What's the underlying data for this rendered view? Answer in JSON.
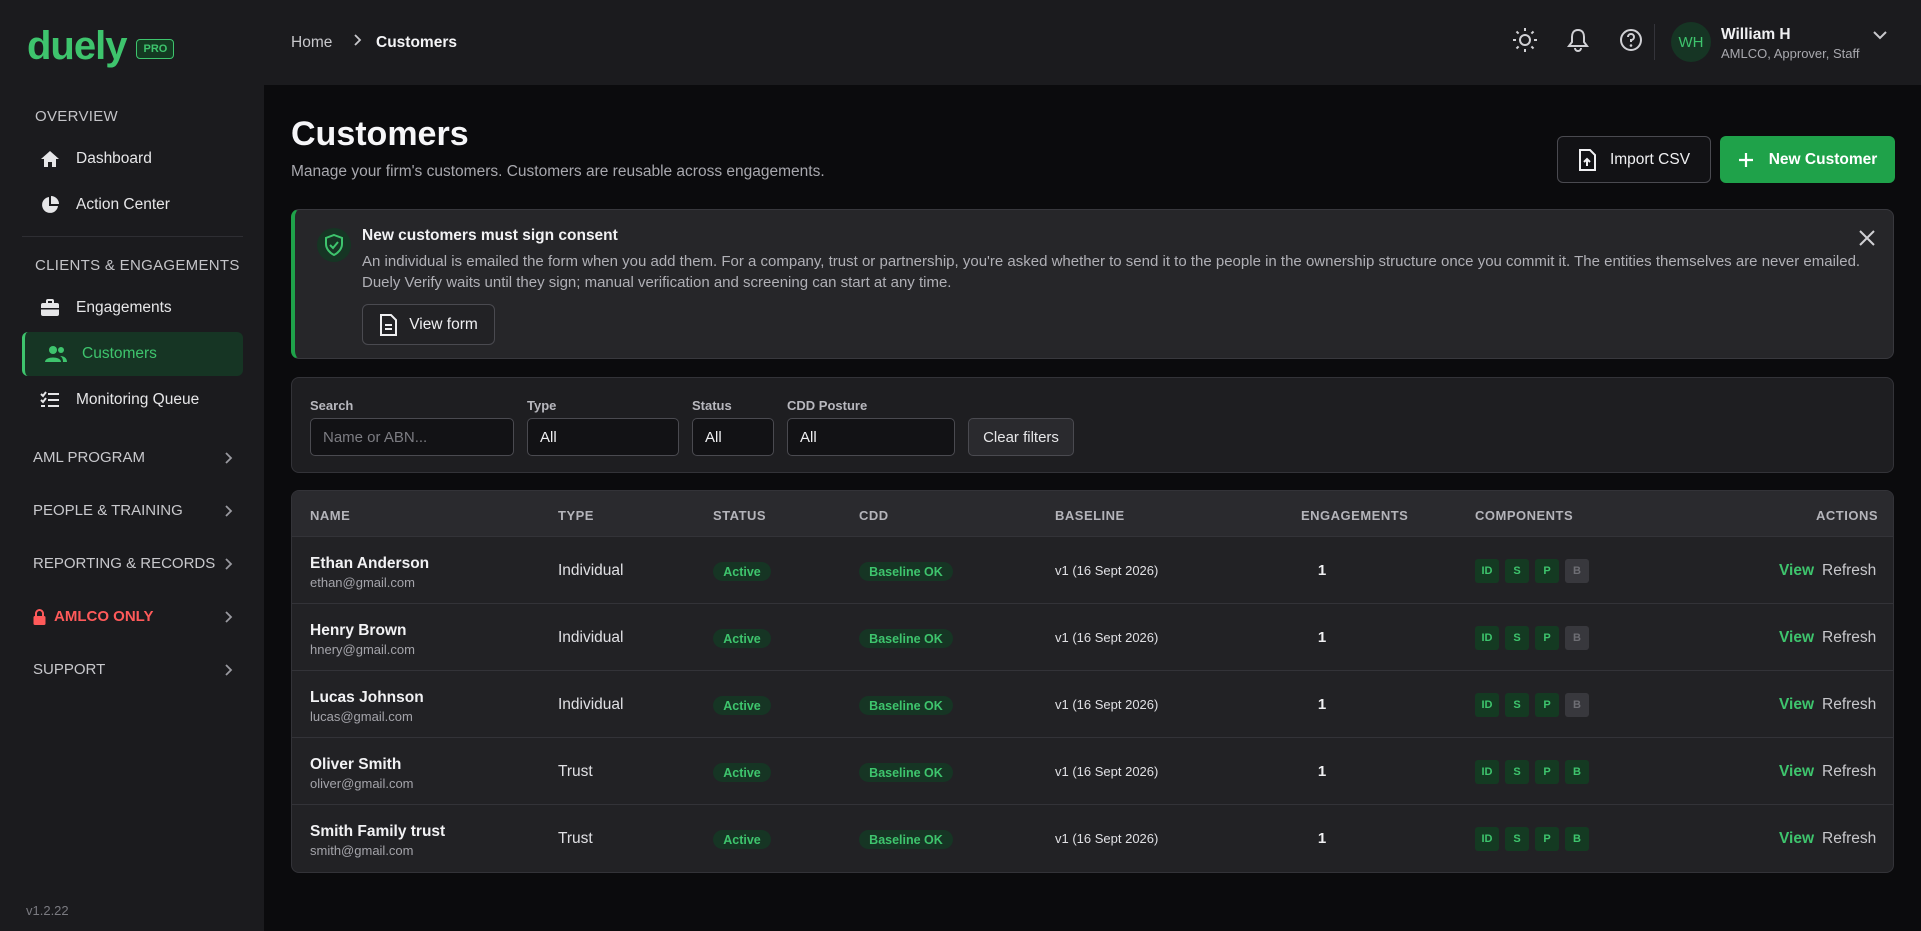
{
  "brand": {
    "logo": "duely",
    "badge": "PRO",
    "version": "v1.2.22",
    "accent": "#3ec46d"
  },
  "sidebar": {
    "overview_label": "OVERVIEW",
    "overview_items": [
      {
        "label": "Dashboard",
        "icon": "home-icon"
      },
      {
        "label": "Action Center",
        "icon": "pie-chart-icon"
      }
    ],
    "clients_label": "CLIENTS & ENGAGEMENTS",
    "clients_items": [
      {
        "label": "Engagements",
        "icon": "briefcase-icon"
      },
      {
        "label": "Customers",
        "icon": "users-icon",
        "active": true
      },
      {
        "label": "Monitoring Queue",
        "icon": "list-check-icon"
      }
    ],
    "groups": [
      {
        "label": "AML PROGRAM"
      },
      {
        "label": "PEOPLE & TRAINING"
      },
      {
        "label": "REPORTING & RECORDS"
      },
      {
        "label": "AMLCO ONLY",
        "icon": "lock-icon",
        "color": "#ff5a5a"
      },
      {
        "label": "SUPPORT"
      }
    ]
  },
  "header": {
    "breadcrumb": [
      "Home",
      "Customers"
    ],
    "user": {
      "initials": "WH",
      "name": "William H",
      "role": "AMLCO, Approver, Staff"
    }
  },
  "page": {
    "title": "Customers",
    "subtitle": "Manage your firm's customers. Customers are reusable across engagements.",
    "import_label": "Import CSV",
    "new_label": "New Customer"
  },
  "banner": {
    "title": "New customers must sign consent",
    "body": "An individual is emailed the form when you add them. For a company, trust or partnership, you're asked whether to send it to the people in the ownership structure once you commit it. The entities themselves are never emailed. Duely Verify waits until they sign; manual verification and screening can start at any time.",
    "button": "View form"
  },
  "filters": {
    "search_label": "Search",
    "search_placeholder": "Name or ABN...",
    "type_label": "Type",
    "type_value": "All",
    "status_label": "Status",
    "status_value": "All",
    "cdd_label": "CDD Posture",
    "cdd_value": "All",
    "clear_label": "Clear filters"
  },
  "table": {
    "columns": [
      "NAME",
      "TYPE",
      "STATUS",
      "CDD",
      "BASELINE",
      "ENGAGEMENTS",
      "COMPONENTS",
      "ACTIONS"
    ],
    "rows": [
      {
        "name": "Ethan Anderson",
        "email": "ethan@gmail.com",
        "type": "Individual",
        "status": "Active",
        "cdd": "Baseline OK",
        "baseline": "v1 (16 Sept 2026)",
        "engagements": "1",
        "components": [
          "ID",
          "S",
          "P",
          "B"
        ],
        "b_active": false,
        "view": "View",
        "refresh": "Refresh"
      },
      {
        "name": "Henry Brown",
        "email": "hnery@gmail.com",
        "type": "Individual",
        "status": "Active",
        "cdd": "Baseline OK",
        "baseline": "v1 (16 Sept 2026)",
        "engagements": "1",
        "components": [
          "ID",
          "S",
          "P",
          "B"
        ],
        "b_active": false,
        "view": "View",
        "refresh": "Refresh"
      },
      {
        "name": "Lucas Johnson",
        "email": "lucas@gmail.com",
        "type": "Individual",
        "status": "Active",
        "cdd": "Baseline OK",
        "baseline": "v1 (16 Sept 2026)",
        "engagements": "1",
        "components": [
          "ID",
          "S",
          "P",
          "B"
        ],
        "b_active": false,
        "view": "View",
        "refresh": "Refresh"
      },
      {
        "name": "Oliver Smith",
        "email": "oliver@gmail.com",
        "type": "Trust",
        "status": "Active",
        "cdd": "Baseline OK",
        "baseline": "v1 (16 Sept 2026)",
        "engagements": "1",
        "components": [
          "ID",
          "S",
          "P",
          "B"
        ],
        "b_active": true,
        "view": "View",
        "refresh": "Refresh"
      },
      {
        "name": "Smith Family trust",
        "email": "smith@gmail.com",
        "type": "Trust",
        "status": "Active",
        "cdd": "Baseline OK",
        "baseline": "v1 (16 Sept 2026)",
        "engagements": "1",
        "components": [
          "ID",
          "S",
          "P",
          "B"
        ],
        "b_active": true,
        "view": "View",
        "refresh": "Refresh"
      }
    ]
  }
}
